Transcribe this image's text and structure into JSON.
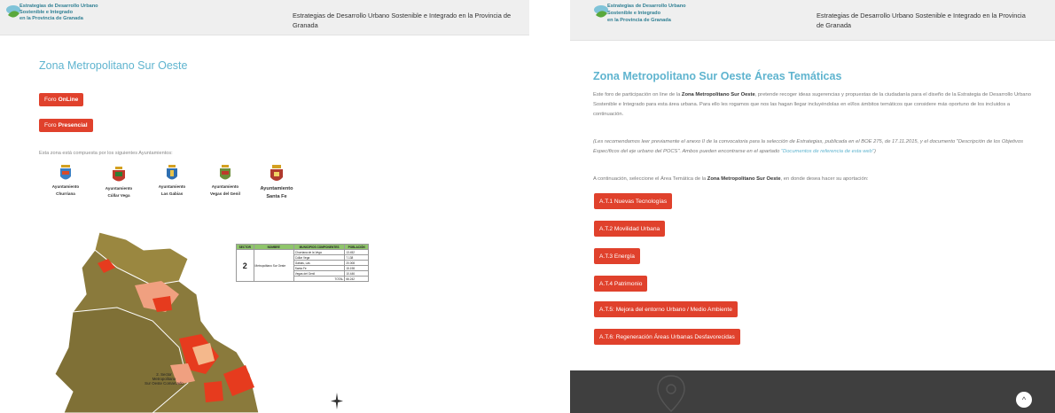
{
  "header": {
    "logo_lines": [
      "Estrategias de Desarrollo Urbano",
      "Sostenible e Integrado",
      "en la Provincia de Granada"
    ],
    "title": "Estrategias de Desarrollo Urbano Sostenible e Integrado en la Provincia de Granada"
  },
  "left": {
    "page_title": "Zona Metropolitano Sur Oeste",
    "foro_online": {
      "prefix": "Foro",
      "emph": "OnLine"
    },
    "foro_presencial": {
      "prefix": "Foro",
      "emph": "Presencial"
    },
    "intro": "Esta zona está compuesta por los siguientes Ayuntamientos:",
    "ayuntamientos": [
      {
        "label1": "Ayuntamiento",
        "label2": "Churriana"
      },
      {
        "label1": "Ayuntamiento",
        "label2": "Cúllar Vega"
      },
      {
        "label1": "Ayuntamiento",
        "label2": "Las Gabias"
      },
      {
        "label1": "Ayuntamiento",
        "label2": "Vegas del Genil"
      },
      {
        "label1": "Ayuntamiento",
        "label2": "Santa Fe"
      }
    ],
    "table": {
      "headers": [
        "SECTOR",
        "NOMBRE",
        "MUNICIPIOS COMPONENTES",
        "POBLACIÓN"
      ],
      "sector": "2",
      "nombre": "Metropolitano Sur Oeste",
      "rows": [
        {
          "municipio": "Churriana de la Vega",
          "poblacion": "13.452"
        },
        {
          "municipio": "Cúllar Vega",
          "poblacion": "7.138"
        },
        {
          "municipio": "Gabias, Las",
          "poblacion": "20.008"
        },
        {
          "municipio": "Santa Fe",
          "poblacion": "15.198"
        },
        {
          "municipio": "Vegas del Genil",
          "poblacion": "10.446"
        }
      ],
      "total_label": "TOTAL",
      "total_value": "66.242"
    },
    "map_label": [
      "2. Sector",
      "Metropolitano",
      "Sur Oeste Comarcado"
    ]
  },
  "right": {
    "page_title": "Zona Metropolitano Sur Oeste Áreas Temáticas",
    "p1_a": "Este foro de participación on line de la ",
    "p1_b": "Zona Metropolitano Sur Oeste",
    "p1_c": ", pretende recoger ideas sugerencias y propuestas de la ciudadanía para el diseño de la Estrategia de Desarrollo Urbano Sostenible e Integrado para esta área urbana. Para ello les rogamos que nos las hagan llegar incluyéndolas en el/los ámbitos temáticos que considere más oportuno de los incluidos a continuación.",
    "p2_a": "(Les recomendamos leer previamente el anexo II de la convocatoria para la selección de Estrategias, publicada en el BOE 275, de 17.11.2015, y el documento \"Descripción de los Objetivos Específicos del eje urbano del POCS\". Ambos pueden encontrarse en el apartado ",
    "p2_link": "\"Documentos de referencia de esta web\"",
    "p2_c": ")",
    "p3_a": "A continuación, seleccione el Área Temática de la ",
    "p3_b": "Zona Metropolitano Sur Oeste",
    "p3_c": ", en donde desea hacer su aportación:",
    "areas": [
      "A.T.1 Nuevas Tecnologías",
      "A.T.2 Movilidad Urbana",
      "A.T.3 Energía",
      "A.T.4 Patrimonio",
      "A.T.5: Mejora del entorno Urbano / Medio Ambiente",
      "A.T.6: Regeneración Áreas Urbanas Desfavorecidas"
    ],
    "scroll_top": "^"
  },
  "colors": {
    "accent": "#e0412c",
    "title": "#5fb4cf",
    "header_bg": "#efefef",
    "footer_bg": "#3f3f3f"
  }
}
